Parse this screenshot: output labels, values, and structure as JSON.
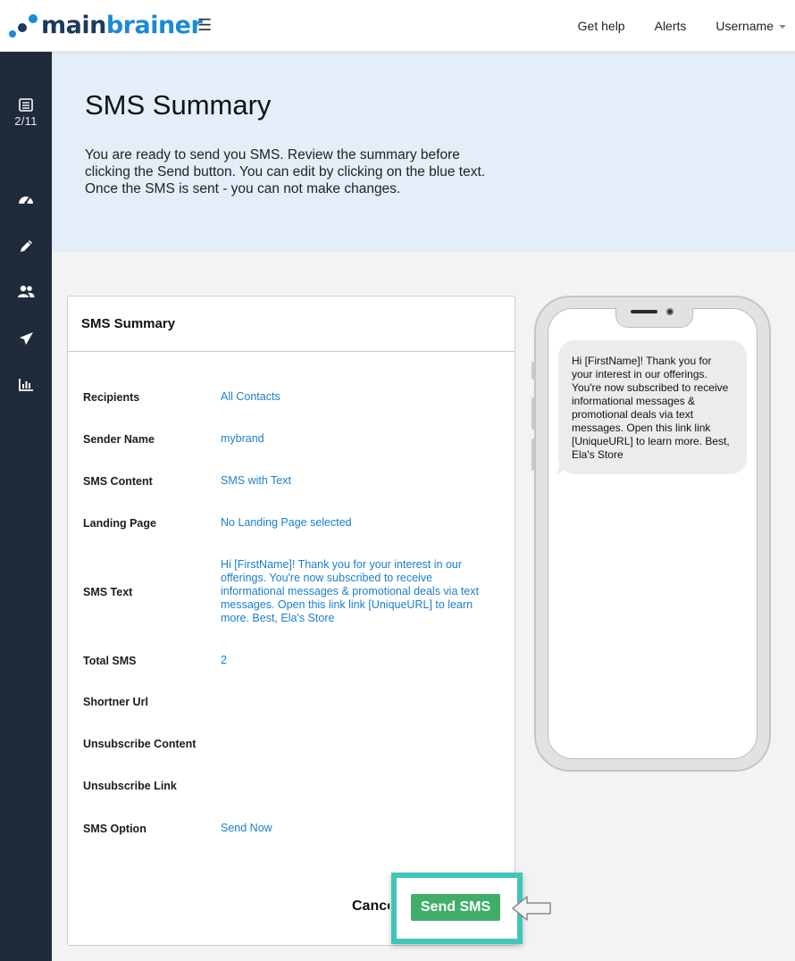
{
  "brand": {
    "part1": "main",
    "part2": "brainer",
    "primary": "#1c3a5c",
    "accent": "#1a8ad4"
  },
  "topnav": {
    "menu_icon": "hamburger-icon",
    "get_help": "Get help",
    "alerts": "Alerts",
    "username": "Username"
  },
  "sidebar": {
    "counter": "2/11",
    "icons": [
      "list-icon",
      "dashboard-gauge-icon",
      "pencil-icon",
      "users-icon",
      "paper-plane-icon",
      "bar-chart-icon"
    ]
  },
  "hero": {
    "title": "SMS Summary",
    "description": "You are ready to send you SMS. Review the summary before clicking the Send button. You can edit by clicking on the blue text. Once the SMS is sent - you can not make changes."
  },
  "summary": {
    "heading": "SMS Summary",
    "rows": [
      {
        "label": "Recipients",
        "value": "All Contacts"
      },
      {
        "label": "Sender Name",
        "value": "mybrand"
      },
      {
        "label": "SMS Content",
        "value": "SMS with Text"
      },
      {
        "label": "Landing Page",
        "value": "No Landing Page selected"
      },
      {
        "label": "SMS Text",
        "value": "Hi [FirstName]! Thank you for your interest in our offerings. You're now subscribed to receive informational messages & promotional deals via text messages. Open this link link [UniqueURL] to learn more. Best, Ela's Store"
      },
      {
        "label": "Total SMS",
        "value": "2"
      },
      {
        "label": "Shortner Url",
        "value": ""
      },
      {
        "label": "Unsubscribe Content",
        "value": ""
      },
      {
        "label": "Unsubscribe Link",
        "value": ""
      },
      {
        "label": "SMS Option",
        "value": "Send Now"
      }
    ]
  },
  "actions": {
    "cancel": "Cancel",
    "send": "Send SMS",
    "send_color": "#3fae6a",
    "highlight_color": "#3ec6b8"
  },
  "phone_preview": {
    "message": "Hi [FirstName]! Thank you for your interest in our offerings. You're now subscribed to receive informational messages & promotional deals via text messages. Open this link link [UniqueURL] to learn more. Best, Ela's Store"
  }
}
